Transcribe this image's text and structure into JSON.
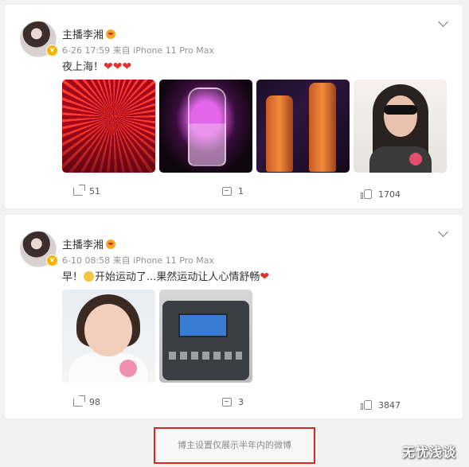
{
  "posts": [
    {
      "username": "主播李湘",
      "timestamp": "6-26 17:59",
      "source": "来自 iPhone 11 Pro Max",
      "text": "夜上海！",
      "hearts": "❤❤❤",
      "images": [
        "nightclub-lights-photo",
        "champagne-glass-photo",
        "champagne-bottles-photo",
        "selfie-sunglasses-photo"
      ],
      "share_count": "51",
      "comment_count": "1",
      "like_count": "1704"
    },
    {
      "username": "主播李湘",
      "timestamp": "6-10 08:58",
      "source": "来自 iPhone 11 Pro Max",
      "text_before_emoji": "早！",
      "text_after_emoji": "开始运动了...果然运动让人心情舒畅",
      "heart": "❤",
      "images": [
        "selfie-photo",
        "treadmill-console-photo"
      ],
      "share_count": "98",
      "comment_count": "3",
      "like_count": "3847"
    }
  ],
  "footer": {
    "note": "博主设置仅展示半年内的微博"
  },
  "watermark": "无忧浅谈",
  "colors": {
    "heart": "#e0312f",
    "verified_badge": "#f8b500",
    "highlight_border": "#d9281b"
  }
}
